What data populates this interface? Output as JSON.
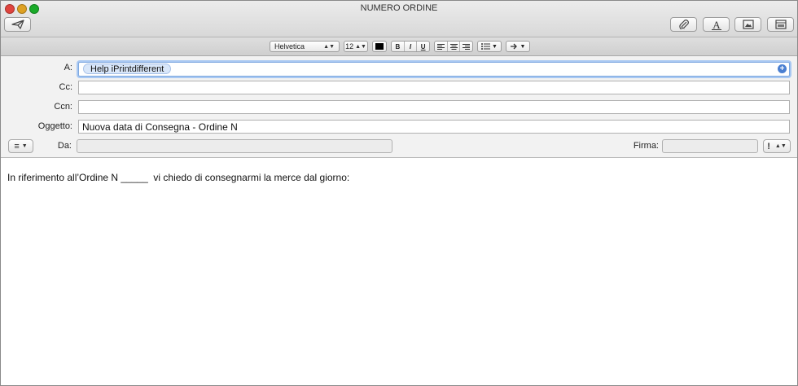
{
  "window": {
    "title": "NUMERO ORDINE"
  },
  "toolbar": {
    "send_icon": "paper-plane-icon",
    "attach_icon": "paperclip-icon",
    "format_icon": "font-a-icon",
    "photo_icon": "photo-browser-icon",
    "template_icon": "stationery-icon"
  },
  "formatbar": {
    "font": "Helvetica",
    "size": "12",
    "bold": "B",
    "italic": "I",
    "underline": "U"
  },
  "header": {
    "to_label": "A:",
    "to_recipients": [
      "Help iPrintdifferent"
    ],
    "cc_label": "Cc:",
    "cc_value": "",
    "bcc_label": "Ccn:",
    "bcc_value": "",
    "subject_label": "Oggetto:",
    "subject_value": "Nuova data di Consegna - Ordine N",
    "from_label": "Da:",
    "from_value": "",
    "signature_label": "Firma:",
    "signature_value": "",
    "priority": "!"
  },
  "body": {
    "text": "In riferimento all’Ordine N _____  vi chiedo di consegnarmi la merce dal giorno:"
  }
}
